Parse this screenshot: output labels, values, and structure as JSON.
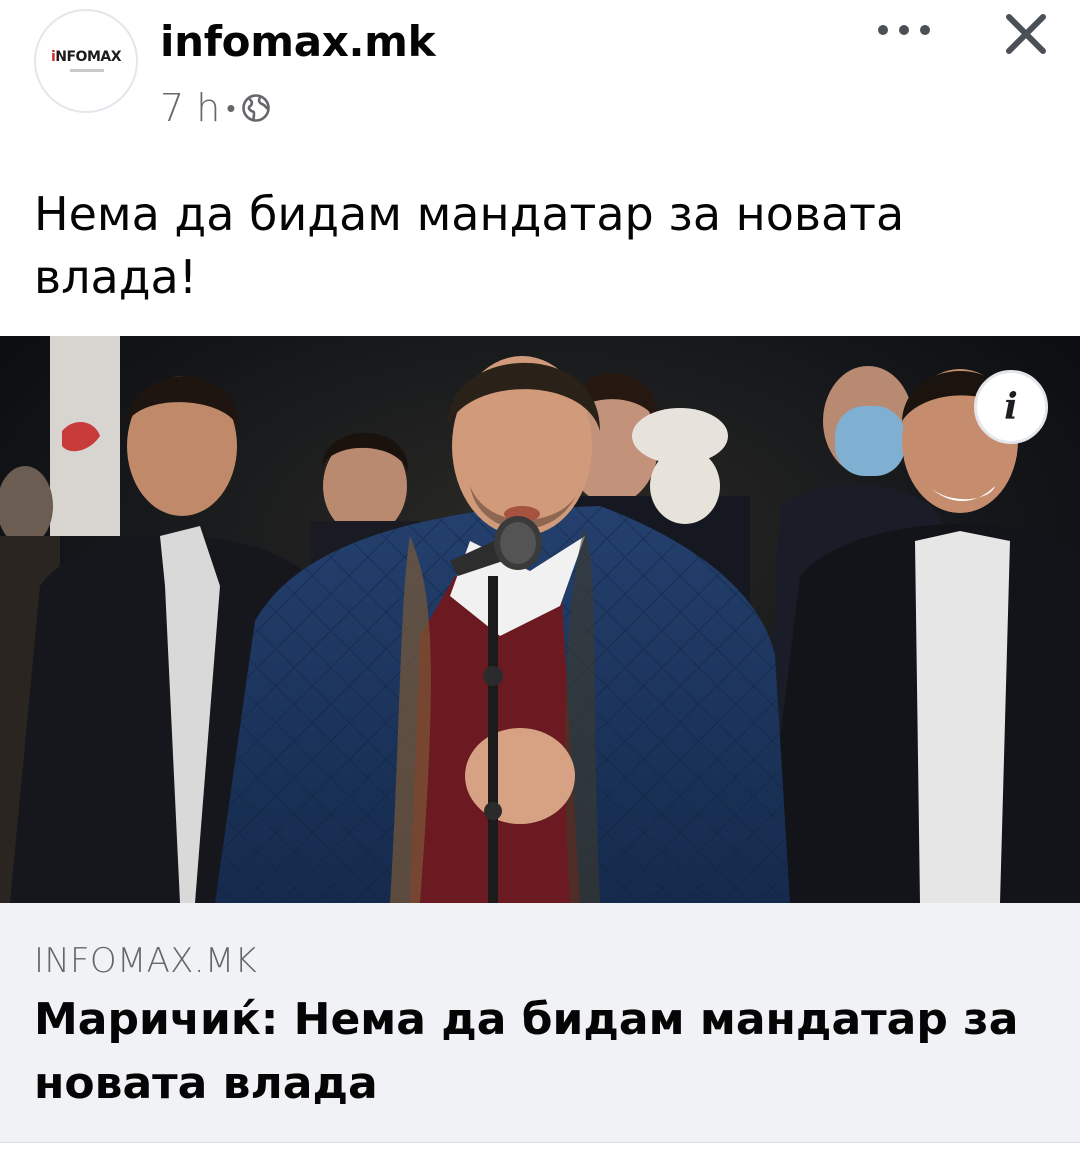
{
  "post": {
    "page_name": "infomax.mk",
    "avatar_logo_prefix": "i",
    "avatar_logo_rest": "NFOMAX",
    "time": "7 h",
    "separator": "•",
    "privacy_icon": "globe-icon",
    "more_icon": "more-horizontal-icon",
    "close_icon": "close-icon",
    "text": "Нема да бидам мандатар за новата влада!"
  },
  "link_preview": {
    "info_icon": "i",
    "domain": "INFOMAX.MK",
    "title": "Маричиќ: Нема да бидам мандатар за новата влада"
  },
  "colors": {
    "text_primary": "#050505",
    "text_secondary": "#65676b",
    "card_background": "#f0f2f5",
    "logo_accent": "#d9262b"
  }
}
